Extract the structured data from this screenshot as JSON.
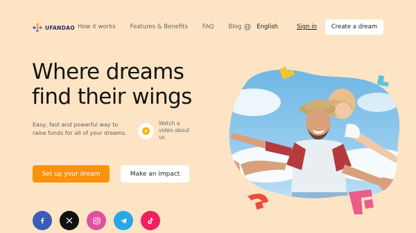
{
  "brand": {
    "name": "UFANDAO"
  },
  "nav": {
    "items": [
      "How it works",
      "Features & Benefits",
      "FAQ",
      "Blog"
    ],
    "language": "English",
    "sign_in": "Sign in",
    "create_button": "Create a dream"
  },
  "hero": {
    "title_line1": "Where dreams",
    "title_line2": "find their wings",
    "subtitle": "Easy, fast and powerful way to raise funds for all of your dreams.",
    "watch_video": "Watch a video about us",
    "primary_cta": "Set up your dream",
    "secondary_cta": "Make an impact"
  },
  "socials": [
    {
      "name": "facebook-icon",
      "color": "#3b5bb8"
    },
    {
      "name": "x-icon",
      "color": "#111111"
    },
    {
      "name": "instagram-icon",
      "color": "#e14fa2"
    },
    {
      "name": "telegram-icon",
      "color": "#27a7e7"
    },
    {
      "name": "tiktok-icon",
      "color": "#f01f5e"
    }
  ],
  "colors": {
    "background": "#fde4c4",
    "accent": "#f9930d",
    "brand_navy": "#2b2b6b"
  }
}
